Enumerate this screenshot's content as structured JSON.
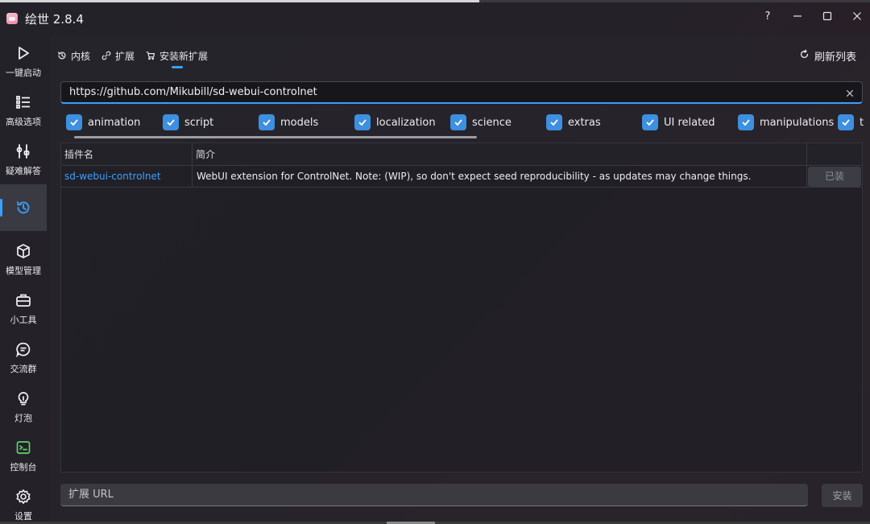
{
  "window": {
    "title": "绘世 2.8.4",
    "help_glyph": "?",
    "minimize_glyph": "—",
    "maximize_glyph": "☐",
    "close_glyph": "✕"
  },
  "sidebar": {
    "items": [
      {
        "label": "一键启动",
        "icon": "play-icon"
      },
      {
        "label": "高级选项",
        "icon": "list-icon"
      },
      {
        "label": "疑难解答",
        "icon": "wrench-icon"
      },
      {
        "label": "",
        "icon": "history-icon",
        "active": true
      },
      {
        "label": "模型管理",
        "icon": "cube-icon"
      },
      {
        "label": "小工具",
        "icon": "toolbox-icon"
      },
      {
        "label": "交流群",
        "icon": "chat-icon"
      },
      {
        "label": "灯泡",
        "icon": "lightbulb-icon"
      },
      {
        "label": "控制台",
        "icon": "console-icon"
      },
      {
        "label": "设置",
        "icon": "settings-icon"
      }
    ]
  },
  "tabs": {
    "core": "内核",
    "extensions": "扩展",
    "install": "安装新扩展",
    "active": "install"
  },
  "toolbar": {
    "refresh_label": "刷新列表"
  },
  "search": {
    "url_value": "https://github.com/Mikubill/sd-webui-controlnet"
  },
  "tags": [
    "animation",
    "script",
    "models",
    "localization",
    "science",
    "extras",
    "UI related",
    "manipulations",
    "t"
  ],
  "table": {
    "headers": {
      "name": "插件名",
      "description": "简介",
      "action": ""
    },
    "rows": [
      {
        "name": "sd-webui-controlnet",
        "description": "WebUI extension for ControlNet. Note: (WIP), so don't expect seed reproducibility - as updates may change things.",
        "action": "已装"
      }
    ]
  },
  "bottom": {
    "url_placeholder": "扩展 URL",
    "install_label": "安装"
  },
  "colors": {
    "accent": "#3aa0ff",
    "checkbox": "#3d8fe0",
    "link": "#3aa0ff"
  }
}
